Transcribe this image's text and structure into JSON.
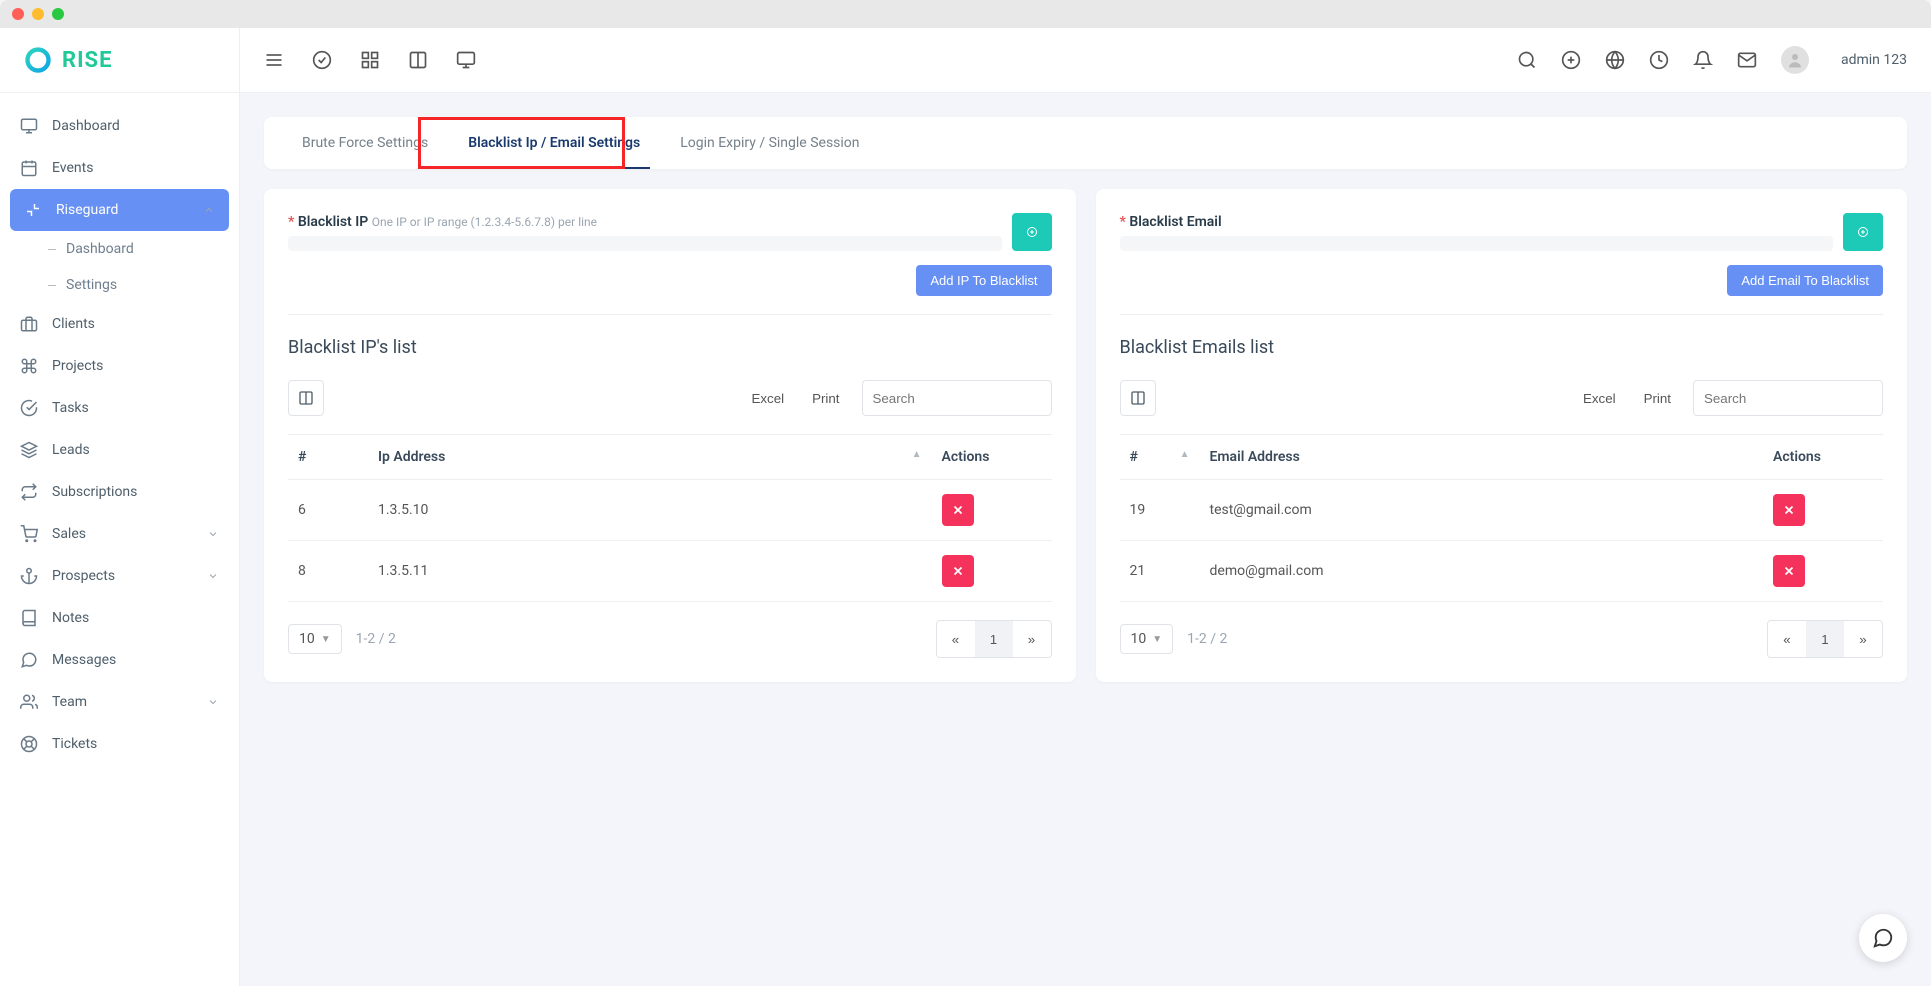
{
  "app": {
    "logo_text": "RISE"
  },
  "header": {
    "username": "admin 123"
  },
  "sidebar": {
    "items": [
      {
        "key": "dashboard",
        "label": "Dashboard"
      },
      {
        "key": "events",
        "label": "Events"
      },
      {
        "key": "riseguard",
        "label": "Riseguard",
        "sub": [
          {
            "key": "rg-dashboard",
            "label": "Dashboard"
          },
          {
            "key": "rg-settings",
            "label": "Settings"
          }
        ]
      },
      {
        "key": "clients",
        "label": "Clients"
      },
      {
        "key": "projects",
        "label": "Projects"
      },
      {
        "key": "tasks",
        "label": "Tasks"
      },
      {
        "key": "leads",
        "label": "Leads"
      },
      {
        "key": "subscriptions",
        "label": "Subscriptions"
      },
      {
        "key": "sales",
        "label": "Sales"
      },
      {
        "key": "prospects",
        "label": "Prospects"
      },
      {
        "key": "notes",
        "label": "Notes"
      },
      {
        "key": "messages",
        "label": "Messages"
      },
      {
        "key": "team",
        "label": "Team"
      },
      {
        "key": "tickets",
        "label": "Tickets"
      }
    ]
  },
  "tabs": {
    "brute_force": "Brute Force Settings",
    "blacklist": "Blacklist Ip / Email Settings",
    "login_expiry": "Login Expiry / Single Session"
  },
  "ip_panel": {
    "title": "Blacklist IP",
    "hint": "One IP or IP range (1.2.3.4-5.6.7.8) per line",
    "add_btn": "Add IP To Blacklist",
    "list_title": "Blacklist IP's list",
    "excel": "Excel",
    "print": "Print",
    "search_placeholder": "Search",
    "cols": {
      "num": "#",
      "ip": "Ip Address",
      "actions": "Actions"
    },
    "rows": [
      {
        "id": "6",
        "ip": "1.3.5.10"
      },
      {
        "id": "8",
        "ip": "1.3.5.11"
      }
    ],
    "page_size": "10",
    "page_info": "1-2 / 2",
    "current_page": "1"
  },
  "email_panel": {
    "title": "Blacklist Email",
    "add_btn": "Add Email To Blacklist",
    "list_title": "Blacklist Emails list",
    "excel": "Excel",
    "print": "Print",
    "search_placeholder": "Search",
    "cols": {
      "num": "#",
      "email": "Email Address",
      "actions": "Actions"
    },
    "rows": [
      {
        "id": "19",
        "email": "test@gmail.com"
      },
      {
        "id": "21",
        "email": "demo@gmail.com"
      }
    ],
    "page_size": "10",
    "page_info": "1-2 / 2",
    "current_page": "1"
  }
}
